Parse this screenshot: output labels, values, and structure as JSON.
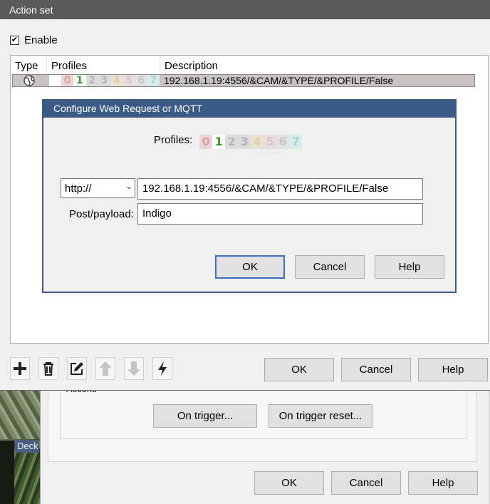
{
  "main_dialog": {
    "title": "Action set",
    "enable_label": "Enable",
    "enable_checked": true,
    "list": {
      "headers": [
        "Type",
        "Profiles",
        "Description"
      ],
      "rows": [
        {
          "type_icon": "globe-icon",
          "description": "192.168.1.19:4556/&CAM/&TYPE/&PROFILE/False"
        }
      ]
    },
    "buttons": {
      "ok": "OK",
      "cancel": "Cancel",
      "help": "Help"
    },
    "toolbar": [
      "add-icon",
      "delete-icon",
      "edit-icon",
      "move-up-icon",
      "move-down-icon",
      "lightning-icon"
    ]
  },
  "profiles": {
    "digits": [
      "0",
      "1",
      "2",
      "3",
      "4",
      "5",
      "6",
      "7"
    ],
    "colors": [
      "#d9a3a3",
      "#3a9a2a",
      "#b6b6b6",
      "#b4b4b4",
      "#d8cfb0",
      "#d6c6c6",
      "#c6c6c6",
      "#a9d3cf"
    ],
    "backgrounds": [
      "#ecd5d5",
      "#ffffff",
      "#dcdcdc",
      "#dcdcdc",
      "#e8e2d0",
      "#e8dcdc",
      "#e2e2e2",
      "#d6ecea"
    ]
  },
  "inner_dialog": {
    "title": "Configure Web Request or MQTT",
    "profiles_label": "Profiles:",
    "protocol": "http://",
    "url": "192.168.1.19:4556/&CAM/&TYPE/&PROFILE/False",
    "payload_label": "Post/payload:",
    "payload": "Indigo",
    "buttons": {
      "ok": "OK",
      "cancel": "Cancel",
      "help": "Help"
    }
  },
  "background_dialog": {
    "group_label": "Actions",
    "on_trigger": "On trigger...",
    "on_trigger_reset": "On trigger reset...",
    "buttons": {
      "ok": "OK",
      "cancel": "Cancel",
      "help": "Help"
    },
    "camera_label": "Deck"
  },
  "colors": {
    "titlebar": "#5a5a5a",
    "inner_titlebar": "#3c5a86",
    "selected_row": "#c9c3c3",
    "default_button_border": "#3c6fc0"
  }
}
